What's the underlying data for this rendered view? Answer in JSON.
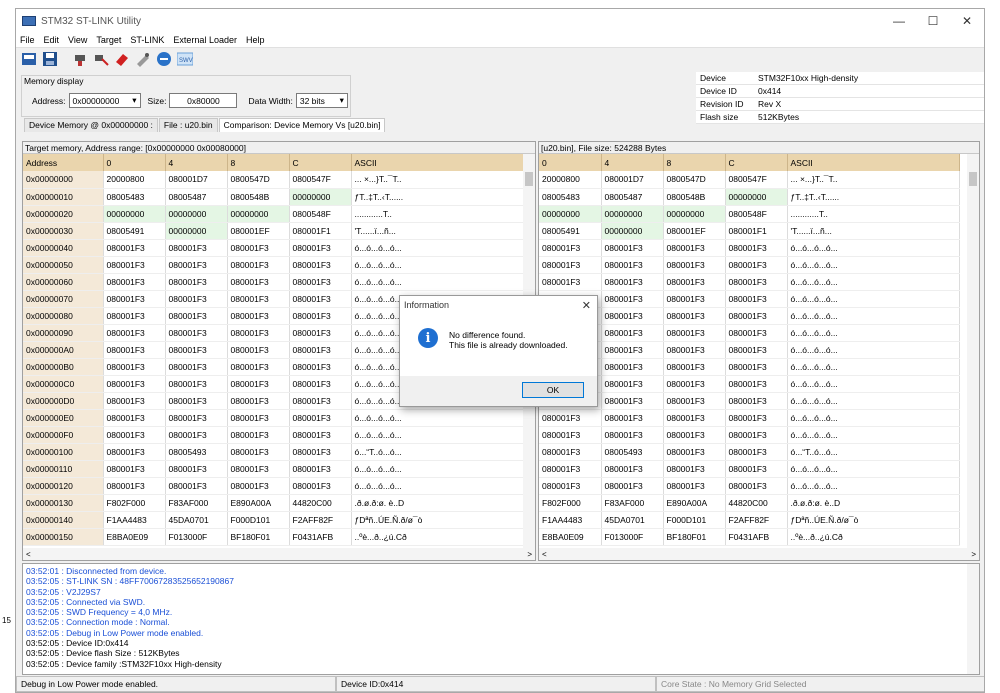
{
  "window": {
    "title": "STM32 ST-LINK Utility"
  },
  "menu": [
    "File",
    "Edit",
    "View",
    "Target",
    "ST-LINK",
    "External Loader",
    "Help"
  ],
  "memory_display": {
    "title": "Memory display",
    "address_label": "Address:",
    "address": "0x00000000",
    "size_label": "Size:",
    "size": "0x80000",
    "width_label": "Data Width:",
    "width": "32 bits"
  },
  "device": [
    [
      "Device",
      "STM32F10xx High-density"
    ],
    [
      "Device ID",
      "0x414"
    ],
    [
      "Revision ID",
      "Rev X"
    ],
    [
      "Flash size",
      "512KBytes"
    ]
  ],
  "tabs": [
    "Device Memory @ 0x00000000 :",
    "File : u20.bin",
    "Comparison: Device Memory Vs [u20.bin]"
  ],
  "left_info": "Target memory, Address range: [0x00000000 0x00080000]",
  "right_info": "[u20.bin], File size: 524288 Bytes",
  "left_headers": [
    "Address",
    "0",
    "4",
    "8",
    "C",
    "ASCII"
  ],
  "right_headers": [
    "0",
    "4",
    "8",
    "C",
    "ASCII"
  ],
  "rows": [
    [
      "0x00000000",
      "20000800",
      "080001D7",
      "0800547D",
      "0800547F",
      "... ×...}T..¯T.."
    ],
    [
      "0x00000010",
      "08005483",
      "08005487",
      "0800548B",
      "00000000",
      "ƒT..‡T..‹T......"
    ],
    [
      "0x00000020",
      "00000000",
      "00000000",
      "00000000",
      "0800548F",
      "............T.."
    ],
    [
      "0x00000030",
      "08005491",
      "00000000",
      "080001EF",
      "080001F1",
      "'T......ï...ñ..."
    ],
    [
      "0x00000040",
      "080001F3",
      "080001F3",
      "080001F3",
      "080001F3",
      "ó...ó...ó...ó..."
    ],
    [
      "0x00000050",
      "080001F3",
      "080001F3",
      "080001F3",
      "080001F3",
      "ó...ó...ó...ó..."
    ],
    [
      "0x00000060",
      "080001F3",
      "080001F3",
      "080001F3",
      "080001F3",
      "ó...ó...ó...ó..."
    ],
    [
      "0x00000070",
      "080001F3",
      "080001F3",
      "080001F3",
      "080001F3",
      "ó...ó...ó...ó..."
    ],
    [
      "0x00000080",
      "080001F3",
      "080001F3",
      "080001F3",
      "080001F3",
      "ó...ó...ó...ó..."
    ],
    [
      "0x00000090",
      "080001F3",
      "080001F3",
      "080001F3",
      "080001F3",
      "ó...ó...ó...ó..."
    ],
    [
      "0x000000A0",
      "080001F3",
      "080001F3",
      "080001F3",
      "080001F3",
      "ó...ó...ó...ó..."
    ],
    [
      "0x000000B0",
      "080001F3",
      "080001F3",
      "080001F3",
      "080001F3",
      "ó...ó...ó...ó..."
    ],
    [
      "0x000000C0",
      "080001F3",
      "080001F3",
      "080001F3",
      "080001F3",
      "ó...ó...ó...ó..."
    ],
    [
      "0x000000D0",
      "080001F3",
      "080001F3",
      "080001F3",
      "080001F3",
      "ó...ó...ó...ó..."
    ],
    [
      "0x000000E0",
      "080001F3",
      "080001F3",
      "080001F3",
      "080001F3",
      "ó...ó...ó...ó..."
    ],
    [
      "0x000000F0",
      "080001F3",
      "080001F3",
      "080001F3",
      "080001F3",
      "ó...ó...ó...ó..."
    ],
    [
      "0x00000100",
      "080001F3",
      "08005493",
      "080001F3",
      "080001F3",
      "ó...“T..ó...ó..."
    ],
    [
      "0x00000110",
      "080001F3",
      "080001F3",
      "080001F3",
      "080001F3",
      "ó...ó...ó...ó..."
    ],
    [
      "0x00000120",
      "080001F3",
      "080001F3",
      "080001F3",
      "080001F3",
      "ó...ó...ó...ó..."
    ],
    [
      "0x00000130",
      "F802F000",
      "F83AF000",
      "E890A00A",
      "44820C00",
      ".ð.ø.ð:ø. è..D"
    ],
    [
      "0x00000140",
      "F1AA4483",
      "45DA0701",
      "F000D101",
      "F2AFF82F",
      "ƒDªñ..ÚE.Ñ.ð/ø¯ò"
    ],
    [
      "0x00000150",
      "E8BA0E09",
      "F013000F",
      "BF180F01",
      "F0431AFB",
      "..ºè...ð..¿ú.Cð"
    ]
  ],
  "log": [
    "03:52:01 : Disconnected from device.",
    "03:52:05 : ST-LINK SN : 48FF70067283525652190867",
    "03:52:05 : V2J29S7",
    "03:52:05 : Connected via SWD.",
    "03:52:05 : SWD Frequency = 4,0 MHz.",
    "03:52:05 : Connection mode : Normal.",
    "03:52:05 : Debug in Low Power mode enabled.",
    "03:52:05 : Device ID:0x414",
    "03:52:05 : Device flash Size : 512KBytes",
    "03:52:05 : Device family :STM32F10xx High-density"
  ],
  "status": [
    "Debug in Low Power mode enabled.",
    "Device ID:0x414",
    "Core State : No Memory Grid Selected"
  ],
  "dialog": {
    "title": "Information",
    "line1": "No difference found.",
    "line2": "This file is already downloaded.",
    "ok": "OK"
  },
  "colors": {
    "header": "#ead5ad",
    "addr": "#f4e9d8",
    "diff": "#e4f6e4",
    "log_blue": "#1a4fd6"
  }
}
